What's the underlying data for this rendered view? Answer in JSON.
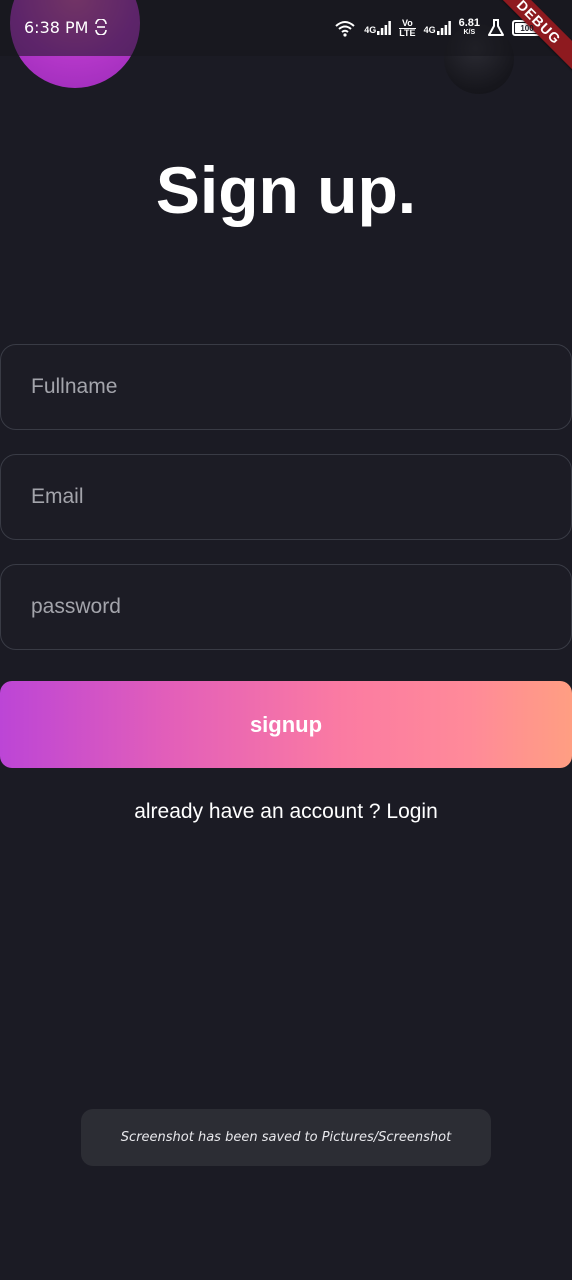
{
  "status_bar": {
    "time": "6:38 PM",
    "network_1": "4G",
    "volte_top": "Vo",
    "volte_bottom": "LTE",
    "network_2": "4G",
    "speed_value": "6.81",
    "speed_unit": "K/S",
    "battery": "100",
    "icons": [
      "sync-icon",
      "wifi-icon",
      "signal-icon",
      "signal-icon",
      "flask-icon",
      "battery-icon"
    ]
  },
  "debug_banner": "DEBUG",
  "page": {
    "title": "Sign up.",
    "fullname_placeholder": "Fullname",
    "email_placeholder": "Email",
    "password_placeholder": "password",
    "signup_label": "signup",
    "login_prompt": "already have an account ?",
    "login_link": "Login"
  },
  "toast": {
    "message": "Screenshot has been saved to  Pictures/Screenshot"
  },
  "colors": {
    "background": "#1b1b24",
    "field_border": "#393b45",
    "button_gradient_start": "#bc45d6",
    "button_gradient_end": "#ff9e82",
    "debug_ribbon": "#8e1a1f"
  }
}
